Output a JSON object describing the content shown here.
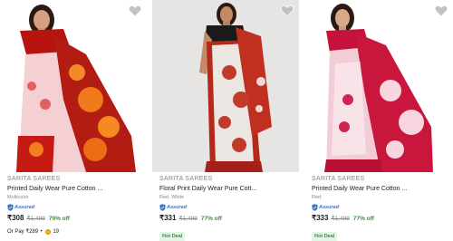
{
  "products": [
    {
      "brand": "SARITA SAREES",
      "title": "Printed Daily Wear Pure Cotton ...",
      "color": "Multicolor",
      "assured_label": "Assured",
      "price": "₹308",
      "mrp": "₹1,499",
      "discount": "79% off",
      "pay_prefix": "Or Pay ₹289 +",
      "coin_count": "19",
      "wishlist_icon": "heart-icon"
    },
    {
      "brand": "SARITA SAREES",
      "title": "Floral Print Daily Wear Pure Cott...",
      "color": "Red, White",
      "assured_label": "Assured",
      "price": "₹331",
      "mrp": "₹1,499",
      "discount": "77% off",
      "badge": "Hot Deal",
      "wishlist_icon": "heart-icon"
    },
    {
      "brand": "SARITA SAREES",
      "title": "Printed Daily Wear Pure Cotton ...",
      "color": "Red",
      "assured_label": "Assured",
      "price": "₹333",
      "mrp": "₹1,499",
      "discount": "77% off",
      "badge": "Hot Deal",
      "wishlist_icon": "heart-icon"
    }
  ],
  "colors": {
    "assured_blue": "#2874f0",
    "discount_green": "#388e3c",
    "muted_text": "#878787",
    "hot_deal_bg": "#e5f5e8"
  }
}
